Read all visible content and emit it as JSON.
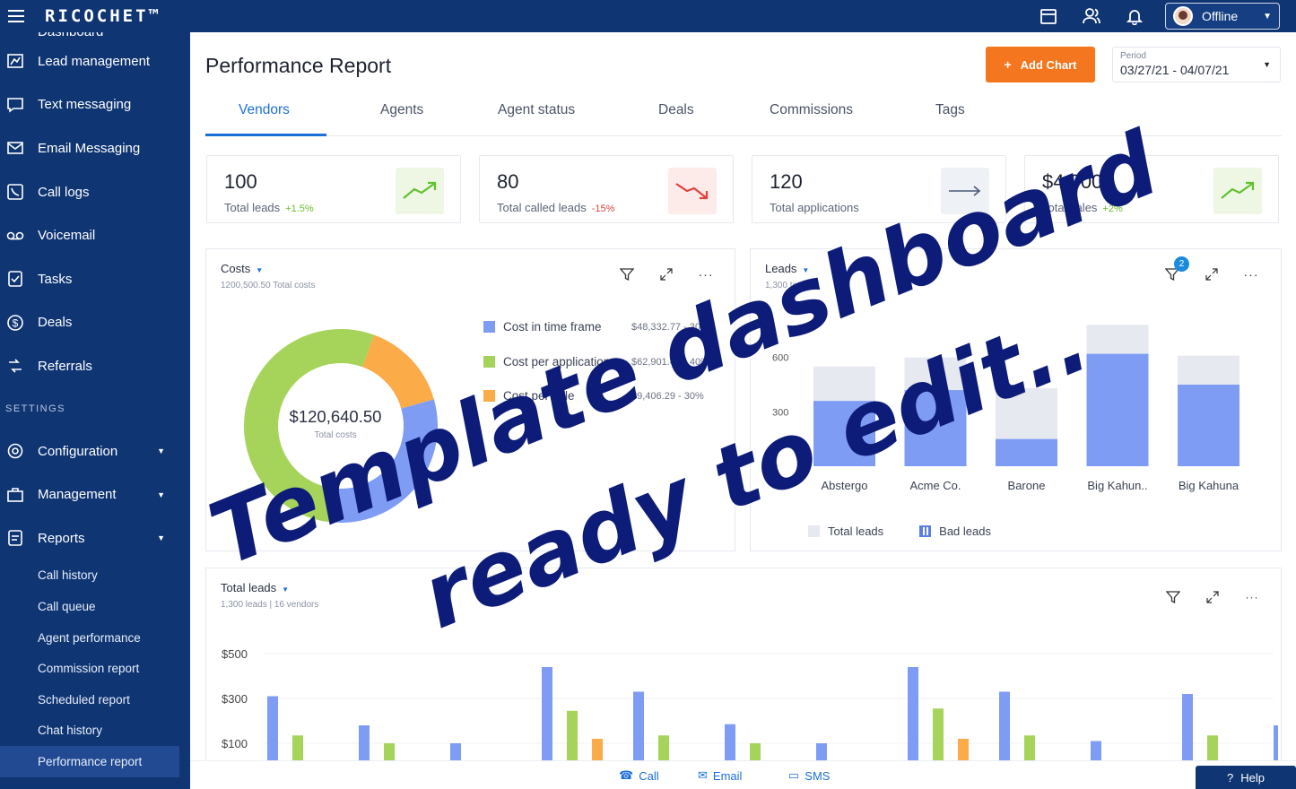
{
  "app": {
    "logo": "RICOCHET™",
    "status": "Offline"
  },
  "sidebar": {
    "first": "Dashboard",
    "items": [
      {
        "label": "Lead management",
        "icon": "lead-icon"
      },
      {
        "label": "Text messaging",
        "icon": "chat-icon"
      },
      {
        "label": "Email Messaging",
        "icon": "mail-icon"
      },
      {
        "label": "Call logs",
        "icon": "phone-log-icon"
      },
      {
        "label": "Voicemail",
        "icon": "voicemail-icon"
      },
      {
        "label": "Tasks",
        "icon": "task-icon"
      },
      {
        "label": "Deals",
        "icon": "dollar-icon"
      },
      {
        "label": "Referrals",
        "icon": "referral-icon"
      }
    ],
    "section": "SETTINGS",
    "groups": [
      {
        "label": "Configuration",
        "icon": "gear-icon"
      },
      {
        "label": "Management",
        "icon": "briefcase-icon"
      },
      {
        "label": "Reports",
        "icon": "report-icon"
      }
    ],
    "subitems": [
      "Call history",
      "Call queue",
      "Agent performance",
      "Commission report",
      "Scheduled report",
      "Chat history",
      "Performance report"
    ]
  },
  "header": {
    "title": "Performance Report",
    "add_chart": "Add Chart",
    "period_label": "Period",
    "period_value": "03/27/21 - 04/07/21"
  },
  "tabs": [
    "Vendors",
    "Agents",
    "Agent status",
    "Deals",
    "Commissions",
    "Tags"
  ],
  "kpis": [
    {
      "value": "100",
      "label": "Total leads",
      "delta": "+1.5%",
      "trend": "up"
    },
    {
      "value": "80",
      "label": "Total called leads",
      "delta": "-15%",
      "trend": "down"
    },
    {
      "value": "120",
      "label": "Total applications",
      "delta": "",
      "trend": "flat"
    },
    {
      "value": "$4,000",
      "label": "Total sales",
      "delta": "+2%",
      "trend": "up"
    }
  ],
  "costs": {
    "title": "Costs",
    "subtitle": "1200,500.50 Total costs",
    "center_value": "$120,640.50",
    "center_label": "Total costs",
    "legend": [
      {
        "label": "Cost in time frame",
        "value": "$48,332.77 - 30%",
        "color": "#7f9cf5"
      },
      {
        "label": "Cost per application",
        "value": "$62,901.44 - 40%",
        "color": "#a6d35a"
      },
      {
        "label": "Cost per sale",
        "value": "$9,406.29 - 30%",
        "color": "#fbab48"
      }
    ]
  },
  "leads": {
    "title": "Leads",
    "subtitle": "1,300 total",
    "badge": "2",
    "legend_total": "Total leads",
    "legend_bad": "Bad leads"
  },
  "total_leads": {
    "title": "Total leads",
    "subtitle": "1,300 leads | 16 vendors"
  },
  "bottom": {
    "call": "Call",
    "email": "Email",
    "sms": "SMS",
    "help": "Help"
  },
  "overlay": {
    "line1": "Template dashboard",
    "line2": "ready to edit.."
  },
  "chart_data": [
    {
      "type": "pie",
      "title": "Costs",
      "categories": [
        "Cost in time frame",
        "Cost per application",
        "Cost per sale"
      ],
      "values": [
        30,
        55,
        15
      ],
      "colors": [
        "#7f9cf5",
        "#a6d35a",
        "#fbab48"
      ]
    },
    {
      "type": "bar",
      "title": "Leads",
      "categories": [
        "Abstergo",
        "Acme Co.",
        "Barone",
        "Big Kahuna Burger",
        "Big Kahuna"
      ],
      "series": [
        {
          "name": "Total leads",
          "values": [
            550,
            600,
            430,
            780,
            610
          ]
        },
        {
          "name": "Bad leads",
          "values": [
            360,
            420,
            150,
            620,
            450
          ]
        }
      ],
      "y_ticks": [
        "0",
        "300",
        "600"
      ],
      "ylim": [
        0,
        900
      ]
    },
    {
      "type": "bar",
      "title": "Total leads",
      "y_ticks": [
        "$100",
        "$300",
        "$500"
      ],
      "ylim": [
        0,
        600
      ],
      "series": [
        {
          "color": "#7f9cf5",
          "values": [
            310,
            180,
            100,
            440,
            330,
            185,
            100,
            440,
            330,
            110,
            320,
            180,
            320
          ]
        },
        {
          "color": "#a6d35a",
          "values": [
            135,
            100,
            0,
            245,
            135,
            100,
            0,
            255,
            135,
            0,
            135,
            100,
            135
          ]
        },
        {
          "color": "#fbab48",
          "values": [
            0,
            0,
            0,
            120,
            0,
            0,
            0,
            120,
            0,
            0,
            0,
            0,
            0
          ]
        }
      ]
    }
  ]
}
